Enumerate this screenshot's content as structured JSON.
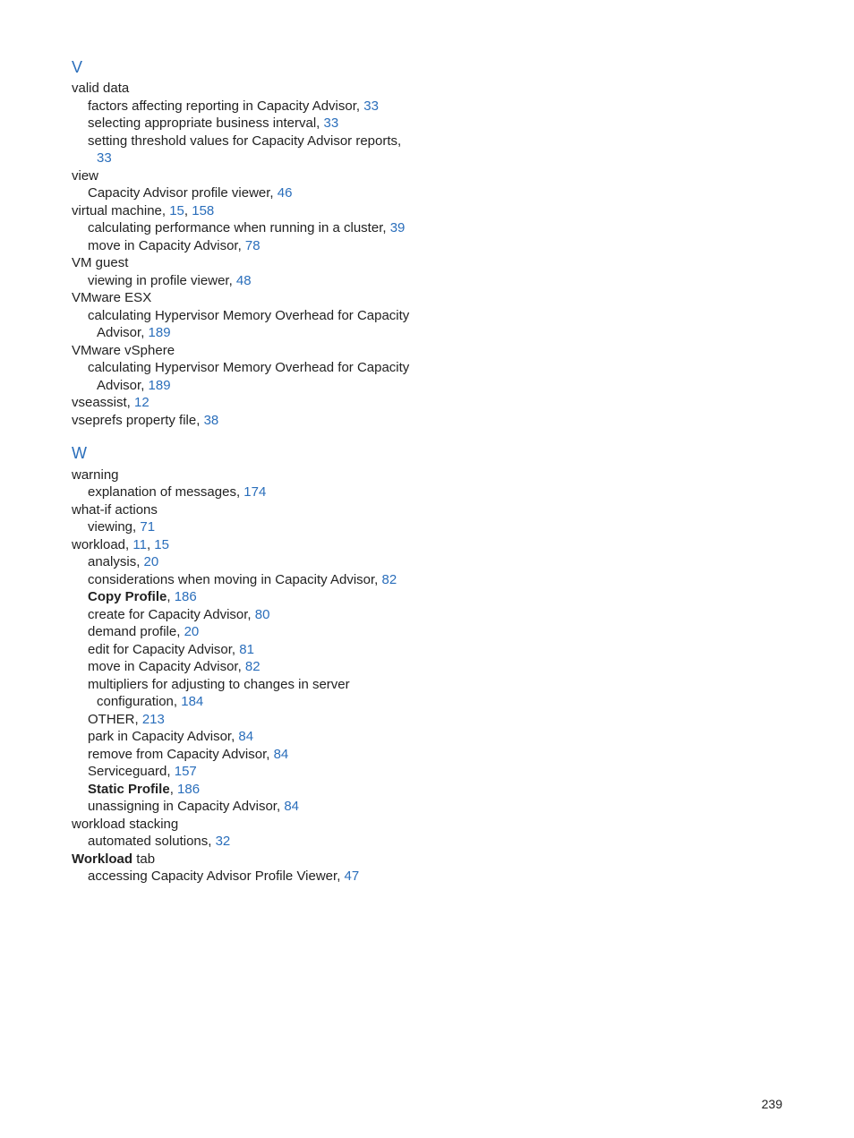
{
  "sections": [
    {
      "letter": "V",
      "entries": [
        {
          "level": 1,
          "text": "valid data"
        },
        {
          "level": 2,
          "text": "factors affecting reporting in Capacity Advisor,",
          "page": "33"
        },
        {
          "level": 2,
          "text": "selecting appropriate business interval,",
          "page": "33"
        },
        {
          "level": 2,
          "text": "setting threshold values for Capacity Advisor reports,"
        },
        {
          "level": 3,
          "text": "",
          "page": "33"
        },
        {
          "level": 1,
          "text": "view"
        },
        {
          "level": 2,
          "text": "Capacity Advisor profile viewer,",
          "page": "46"
        },
        {
          "level": 1,
          "text": "virtual machine,",
          "page": "15",
          "extraPages": [
            "158"
          ]
        },
        {
          "level": 2,
          "text": "calculating performance when running in a cluster,",
          "page": "39"
        },
        {
          "level": 2,
          "text": "move in Capacity Advisor,",
          "page": "78"
        },
        {
          "level": 1,
          "text": "VM guest"
        },
        {
          "level": 2,
          "text": "viewing in profile viewer,",
          "page": "48"
        },
        {
          "level": 1,
          "text": "VMware ESX"
        },
        {
          "level": 2,
          "text": "calculating Hypervisor Memory Overhead for Capacity"
        },
        {
          "level": 3,
          "text": "Advisor,",
          "page": "189"
        },
        {
          "level": 1,
          "text": "VMware vSphere"
        },
        {
          "level": 2,
          "text": "calculating Hypervisor Memory Overhead for Capacity"
        },
        {
          "level": 3,
          "text": "Advisor,",
          "page": "189"
        },
        {
          "level": 1,
          "text": "vseassist,",
          "page": "12"
        },
        {
          "level": 1,
          "text": "vseprefs property file,",
          "page": "38"
        }
      ]
    },
    {
      "letter": "W",
      "entries": [
        {
          "level": 1,
          "text": "warning"
        },
        {
          "level": 2,
          "text": "explanation of messages,",
          "page": "174"
        },
        {
          "level": 1,
          "text": "what-if actions"
        },
        {
          "level": 2,
          "text": "viewing,",
          "page": "71"
        },
        {
          "level": 1,
          "text": "workload,",
          "page": "11",
          "extraPages": [
            "15"
          ]
        },
        {
          "level": 2,
          "text": "analysis,",
          "page": "20"
        },
        {
          "level": 2,
          "text": "considerations when moving in Capacity Advisor,",
          "page": "82"
        },
        {
          "level": 2,
          "boldText": "Copy Profile",
          "afterBold": ",",
          "page": "186"
        },
        {
          "level": 2,
          "text": "create for Capacity Advisor,",
          "page": "80"
        },
        {
          "level": 2,
          "text": "demand profile,",
          "page": "20"
        },
        {
          "level": 2,
          "text": "edit for Capacity Advisor,",
          "page": "81"
        },
        {
          "level": 2,
          "text": "move in Capacity Advisor,",
          "page": "82"
        },
        {
          "level": 2,
          "text": "multipliers for adjusting to changes in server"
        },
        {
          "level": 3,
          "text": "configuration,",
          "page": "184"
        },
        {
          "level": 2,
          "text": "OTHER,",
          "page": "213"
        },
        {
          "level": 2,
          "text": "park in Capacity Advisor,",
          "page": "84"
        },
        {
          "level": 2,
          "text": "remove from Capacity Advisor,",
          "page": "84"
        },
        {
          "level": 2,
          "text": "Serviceguard,",
          "page": "157"
        },
        {
          "level": 2,
          "boldText": "Static Profile",
          "afterBold": ",",
          "page": "186"
        },
        {
          "level": 2,
          "text": "unassigning in Capacity Advisor,",
          "page": "84"
        },
        {
          "level": 1,
          "text": "workload stacking"
        },
        {
          "level": 2,
          "text": "automated solutions,",
          "page": "32"
        },
        {
          "level": 1,
          "boldText": "Workload",
          "afterBold": " tab"
        },
        {
          "level": 2,
          "text": "accessing Capacity Advisor Profile Viewer,",
          "page": "47"
        }
      ]
    }
  ],
  "pageNumber": "239"
}
